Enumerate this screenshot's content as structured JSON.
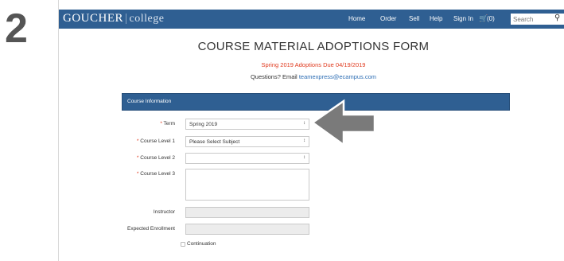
{
  "step_number": "2",
  "header": {
    "brand_main": "GOUCHER",
    "brand_separator": "|",
    "brand_sub": "college",
    "nav": [
      "Home",
      "Order",
      "Sell",
      "Help",
      "Sign In"
    ],
    "cart_count": "(0)",
    "search_placeholder": "Search"
  },
  "form": {
    "title": "COURSE MATERIAL ADOPTIONS FORM",
    "due_notice": "Spring 2019 Adoptions Due 04/19/2019",
    "contact_prefix": "Questions? Email ",
    "contact_email": "teamexpress@ecampus.com",
    "section_title": "Course Information",
    "required_mark": "*",
    "fields": {
      "term_label": "Term",
      "term_value": "Spring 2019",
      "course_level_1_label": "Course Level 1",
      "course_level_1_value": "Please Select Subject",
      "course_level_2_label": "Course Level 2",
      "course_level_2_value": "",
      "course_level_3_label": "Course Level 3",
      "instructor_label": "Instructor",
      "expected_enrollment_label": "Expected Enrollment",
      "continuation_label": "Continuation"
    }
  },
  "icons": {
    "select_chevron": "up-down-chevron-icon",
    "cart": "cart-icon",
    "search": "search-icon",
    "pointer": "left-arrow-icon"
  },
  "colors": {
    "nav_bg": "#2f5f92",
    "required": "#e03a1e",
    "link": "#2f6fb5",
    "arrow": "#7a7a7a"
  }
}
